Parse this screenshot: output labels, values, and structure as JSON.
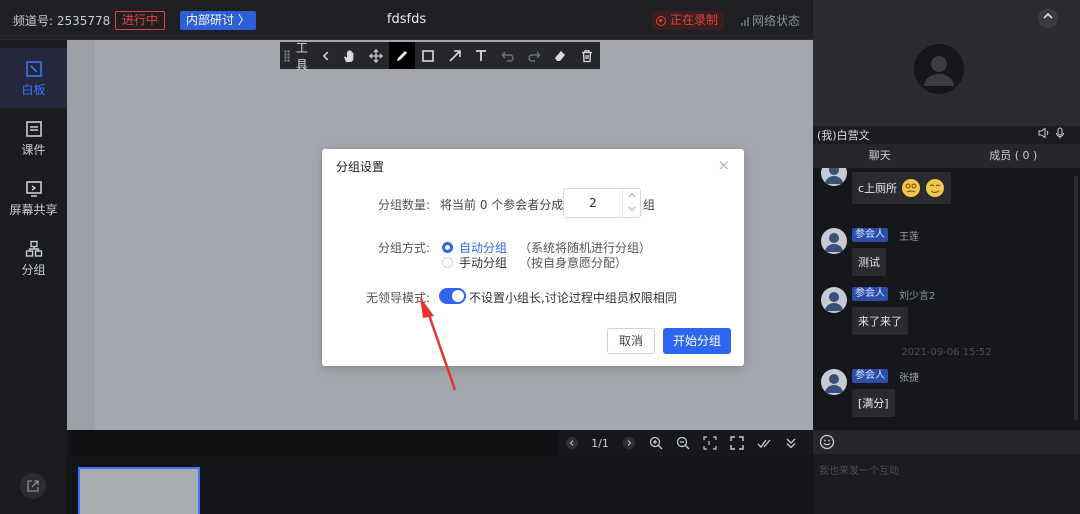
{
  "topbar": {
    "channel": "频道号: 2535778",
    "live_badge": "进行中",
    "meeting_badge": "内部研讨 〉",
    "title": "fdsfds",
    "recording": "正在录制",
    "network": "网络状态"
  },
  "nav": {
    "items": [
      {
        "label": "白板",
        "icon": "whiteboard-icon"
      },
      {
        "label": "课件",
        "icon": "courseware-icon"
      },
      {
        "label": "屏幕共享",
        "icon": "screen-share-icon"
      },
      {
        "label": "分组",
        "icon": "group-icon"
      }
    ]
  },
  "toolbar": {
    "label": "工具",
    "tools": [
      "hand-icon",
      "move-icon",
      "pen-icon",
      "rectangle-icon",
      "arrow-icon",
      "text-icon",
      "undo-icon",
      "redo-icon",
      "eraser-icon",
      "trash-icon"
    ]
  },
  "board_controls": {
    "page": "1/1"
  },
  "modal": {
    "title": "分组设置",
    "close": "×",
    "count_label": "分组数量:",
    "count_prefix": "将当前 0 个参会者分成",
    "count_value": "2",
    "count_unit": "组",
    "method_label": "分组方式:",
    "method_options": [
      {
        "label": "自动分组",
        "hint": "（系统将随机进行分组）",
        "selected": true
      },
      {
        "label": "手动分组",
        "hint": "（按自身意愿分配）",
        "selected": false
      }
    ],
    "leaderless_label": "无领导模式:",
    "leaderless_on": true,
    "leaderless_text": "不设置小组长,讨论过程中组员权限相同",
    "cancel": "取消",
    "start": "开始分组"
  },
  "right_panel": {
    "my_name": "(我)白营文",
    "tabs": [
      "聊天",
      "成员 ( 0 )"
    ],
    "messages": [
      {
        "role": "",
        "sender": "",
        "text": "c上厕所"
      },
      {
        "role": "参会人",
        "sender": "王莲",
        "text": "测试"
      },
      {
        "role": "参会人",
        "sender": "刘少言2",
        "text": "来了来了"
      },
      {
        "role": "参会人",
        "sender": "张捷",
        "text": "[满分]"
      }
    ],
    "timestamp": "2021-09-06 15:52",
    "input_placeholder": "我也来发一个互动"
  },
  "colors": {
    "accent": "#2f66f0",
    "live": "#e0443e",
    "annotation_arrow": "#e8322e"
  }
}
